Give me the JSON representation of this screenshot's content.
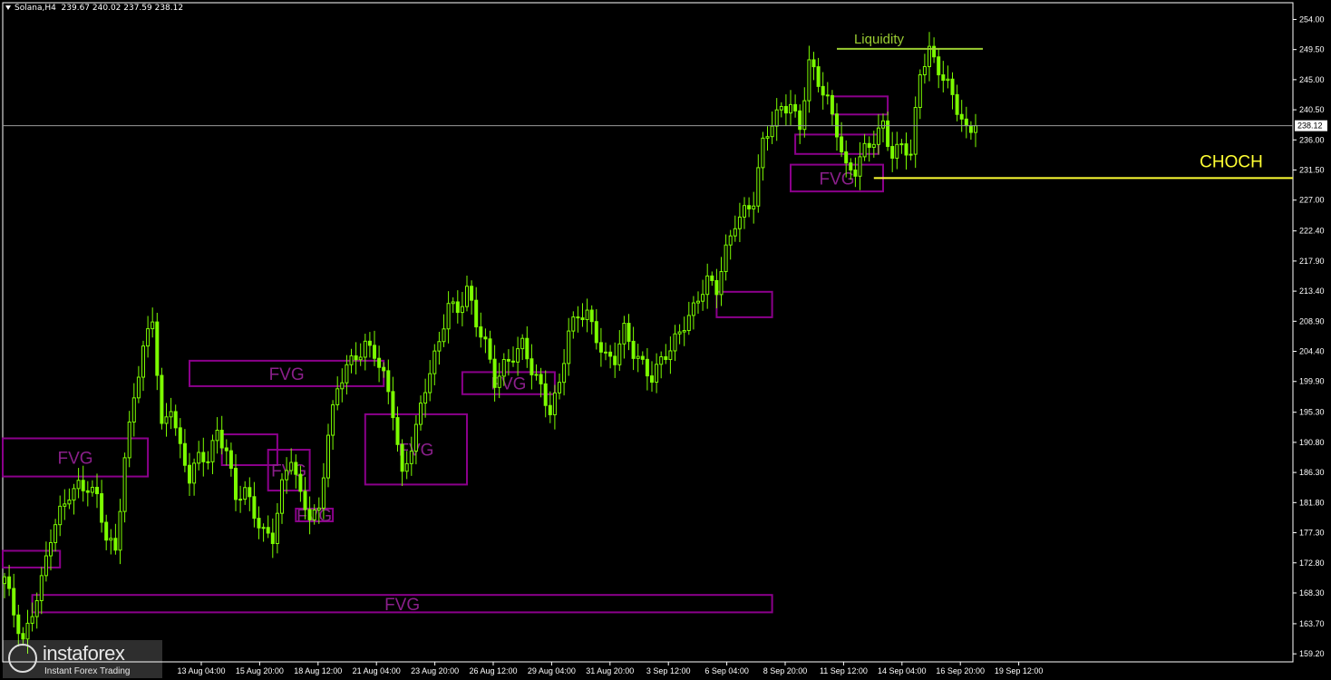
{
  "header": {
    "symbol": "Solana,H4",
    "ohlc": "239.67 240.02 237.59 238.12"
  },
  "logo": {
    "name": "instaforex",
    "tagline": "Instant Forex Trading"
  },
  "colors": {
    "background": "#000000",
    "candle": "#7cfc00",
    "fvg_box": "#8b008b",
    "fvg_text": "#8b1f8b",
    "choch": "#ffff33",
    "liquidity": "#9acd32",
    "axis": "#ffffff"
  },
  "chart_data": {
    "type": "candlestick",
    "symbol": "Solana",
    "timeframe": "H4",
    "ylim": [
      158.0,
      256.5
    ],
    "grid": false,
    "current_price": 238.12,
    "y_ticks": [
      "254.00",
      "249.50",
      "245.00",
      "240.50",
      "236.00",
      "231.50",
      "227.00",
      "222.40",
      "217.90",
      "213.40",
      "208.90",
      "204.40",
      "199.90",
      "195.30",
      "190.80",
      "186.30",
      "181.80",
      "177.30",
      "172.80",
      "168.30",
      "163.70",
      "159.20"
    ],
    "x_ticks": [
      "13 Aug 04:00",
      "15 Aug 20:00",
      "18 Aug 12:00",
      "21 Aug 04:00",
      "23 Aug 20:00",
      "26 Aug 12:00",
      "29 Aug 04:00",
      "31 Aug 20:00",
      "3 Sep 12:00",
      "6 Sep 04:00",
      "8 Sep 20:00",
      "11 Sep 12:00",
      "14 Sep 04:00",
      "16 Sep 20:00",
      "19 Sep 12:00"
    ],
    "close_path": [
      [
        0,
        170.0
      ],
      [
        2,
        165.0
      ],
      [
        4,
        161.5
      ],
      [
        6,
        166.0
      ],
      [
        8,
        170.0
      ],
      [
        10,
        176.0
      ],
      [
        12,
        180.0
      ],
      [
        14,
        183.5
      ],
      [
        16,
        185.0
      ],
      [
        18,
        184.0
      ],
      [
        20,
        182.0
      ],
      [
        22,
        176.0
      ],
      [
        24,
        175.0
      ],
      [
        26,
        189.0
      ],
      [
        28,
        198.0
      ],
      [
        30,
        204.0
      ],
      [
        32,
        209.0
      ],
      [
        34,
        193.0
      ],
      [
        36,
        197.0
      ],
      [
        38,
        190.0
      ],
      [
        40,
        185.0
      ],
      [
        42,
        188.0
      ],
      [
        44,
        188.5
      ],
      [
        46,
        193.0
      ],
      [
        48,
        190.0
      ],
      [
        50,
        182.0
      ],
      [
        52,
        183.0
      ],
      [
        54,
        180.0
      ],
      [
        56,
        178.0
      ],
      [
        58,
        177.0
      ],
      [
        60,
        184.0
      ],
      [
        62,
        188.0
      ],
      [
        64,
        182.5
      ],
      [
        66,
        180.5
      ],
      [
        68,
        181.0
      ],
      [
        70,
        192.0
      ],
      [
        72,
        198.0
      ],
      [
        74,
        202.0
      ],
      [
        76,
        204.0
      ],
      [
        78,
        206.0
      ],
      [
        80,
        204.0
      ],
      [
        82,
        200.0
      ],
      [
        84,
        195.0
      ],
      [
        86,
        186.0
      ],
      [
        88,
        191.0
      ],
      [
        90,
        196.0
      ],
      [
        92,
        201.0
      ],
      [
        94,
        205.0
      ],
      [
        96,
        212.0
      ],
      [
        98,
        211.0
      ],
      [
        100,
        214.0
      ],
      [
        102,
        208.0
      ],
      [
        104,
        205.0
      ],
      [
        106,
        200.0
      ],
      [
        108,
        203.0
      ],
      [
        110,
        204.0
      ],
      [
        112,
        205.0
      ],
      [
        114,
        201.0
      ],
      [
        116,
        199.0
      ],
      [
        118,
        196.0
      ],
      [
        120,
        200.0
      ],
      [
        122,
        207.0
      ],
      [
        124,
        209.0
      ],
      [
        126,
        210.0
      ],
      [
        128,
        207.0
      ],
      [
        130,
        204.0
      ],
      [
        132,
        203.0
      ],
      [
        134,
        207.0
      ],
      [
        136,
        204.0
      ],
      [
        138,
        203.0
      ],
      [
        140,
        201.0
      ],
      [
        142,
        203.0
      ],
      [
        144,
        204.0
      ],
      [
        146,
        207.0
      ],
      [
        148,
        210.0
      ],
      [
        150,
        213.0
      ],
      [
        152,
        215.0
      ],
      [
        154,
        213.0
      ],
      [
        156,
        219.0
      ],
      [
        158,
        224.0
      ],
      [
        160,
        226.0
      ],
      [
        162,
        227.0
      ],
      [
        164,
        235.0
      ],
      [
        166,
        238.0
      ],
      [
        168,
        241.0
      ],
      [
        170,
        242.0
      ],
      [
        172,
        238.0
      ],
      [
        174,
        247.0
      ],
      [
        176,
        244.0
      ],
      [
        178,
        242.0
      ],
      [
        180,
        238.0
      ],
      [
        182,
        232.0
      ],
      [
        184,
        231.0
      ],
      [
        186,
        234.0
      ],
      [
        188,
        236.0
      ],
      [
        190,
        239.0
      ],
      [
        192,
        234.0
      ],
      [
        194,
        235.0
      ],
      [
        196,
        233.0
      ],
      [
        198,
        246.0
      ],
      [
        200,
        250.0
      ],
      [
        202,
        247.0
      ],
      [
        204,
        244.0
      ],
      [
        206,
        240.0
      ],
      [
        208,
        237.0
      ],
      [
        210,
        238.12
      ]
    ],
    "annotations": {
      "fvg_zones": [
        {
          "label": "FVG",
          "from_bar": -1,
          "to_bar": 31,
          "low": 185.7,
          "high": 191.4
        },
        {
          "label": "FVG",
          "from_bar": 40,
          "to_bar": 82,
          "low": 199.2,
          "high": 203.0
        },
        {
          "label": "",
          "from_bar": 47,
          "to_bar": 59,
          "low": 187.4,
          "high": 192.0
        },
        {
          "label": "FVG",
          "from_bar": 57,
          "to_bar": 66,
          "low": 183.6,
          "high": 189.7
        },
        {
          "label": "FVG",
          "from_bar": 63,
          "to_bar": 71,
          "low": 179.0,
          "high": 180.9
        },
        {
          "label": "FVG",
          "from_bar": 78,
          "to_bar": 100,
          "low": 184.5,
          "high": 195.0
        },
        {
          "label": "FVG",
          "from_bar": 99,
          "to_bar": 119,
          "low": 198.0,
          "high": 201.3
        },
        {
          "label": "",
          "from_bar": 154,
          "to_bar": 166,
          "low": 209.5,
          "high": 213.3
        },
        {
          "label": "FVG",
          "from_bar": 170,
          "to_bar": 190,
          "low": 228.3,
          "high": 232.3
        },
        {
          "label": "",
          "from_bar": 171,
          "to_bar": 189,
          "low": 233.9,
          "high": 236.8
        },
        {
          "label": "",
          "from_bar": 179,
          "to_bar": 191,
          "low": 239.8,
          "high": 242.5
        },
        {
          "label": "",
          "from_bar": -1,
          "to_bar": 12,
          "low": 172.1,
          "high": 174.6
        },
        {
          "label": "FVG",
          "from_bar": 6,
          "to_bar": 166,
          "low": 165.4,
          "high": 168.0
        }
      ],
      "choch": {
        "label": "CHOCH",
        "price": 230.3,
        "from_bar": 188
      },
      "liquidity": {
        "label": "Liquidity",
        "price": 249.6,
        "from_bar": 180,
        "to_bar": 210
      }
    }
  }
}
